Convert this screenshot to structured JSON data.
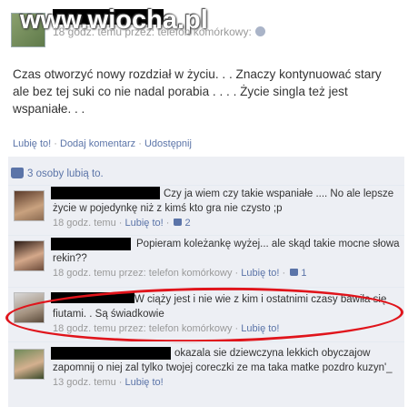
{
  "watermark": "www.wiocha.pl",
  "post": {
    "meta": "18 godz. temu przez: telefon komórkowy:",
    "text": "Czas otworzyć nowy rozdział w życiu. . . Znaczy kontynuować stary ale bez tej suki co nie nadal porabia . . . . Życie singla też jest wspaniałe. . .",
    "actions": {
      "like": "Lubię to!",
      "comment": "Dodaj komentarz",
      "share": "Udostępnij",
      "separator": "·"
    },
    "likes": "3 osoby lubią to."
  },
  "comments": [
    {
      "text": "Czy ja wiem czy takie wspaniałe .... No ale lepsze życie w pojedynkę niż z kimś kto gra nie czysto ;p",
      "time": "18 godz. temu",
      "like": "Lubię to!",
      "likes_count": "2"
    },
    {
      "text": "Popieram koleżankę wyżej... ale skąd takie mocne słowa rekin??",
      "time": "18 godz. temu przez: telefon komórkowy",
      "like": "Lubię to!",
      "likes_count": "1"
    },
    {
      "text": "W ciąży jest i nie wie z kim i ostatnimi czasy bawiła się fiutami. . Są świadkowie",
      "time": "18 godz. temu przez: telefon komórkowy",
      "like": "Lubię to!"
    },
    {
      "text": "okazala sie dziewczyna lekkich obyczajow zapomnij o niej zal tylko twojej coreczki ze ma taka matke pozdro kuzyn'_",
      "time": "13 godz. temu",
      "like": "Lubię to!"
    }
  ],
  "colors": {
    "link": "#5b74a8",
    "feedback_bg": "#edeff4",
    "highlight_ellipse": "#e0141b"
  }
}
